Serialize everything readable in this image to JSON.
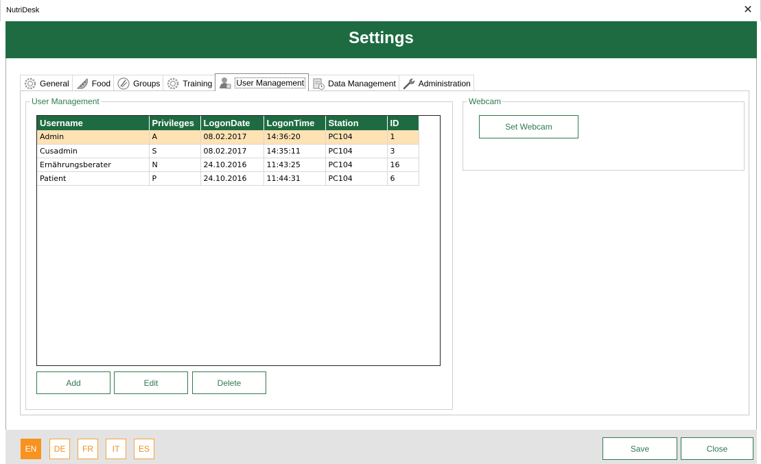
{
  "window": {
    "title": "NutriDesk",
    "close_glyph": "✕"
  },
  "header": {
    "title": "Settings"
  },
  "tabs": [
    {
      "label": "General",
      "icon": "gear-icon"
    },
    {
      "label": "Food",
      "icon": "pizza-icon"
    },
    {
      "label": "Groups",
      "icon": "fork-knife-icon"
    },
    {
      "label": "Training",
      "icon": "gear-icon"
    },
    {
      "label": "User Management",
      "icon": "user-icon",
      "active": true
    },
    {
      "label": "Data Management",
      "icon": "database-icon"
    },
    {
      "label": "Administration",
      "icon": "wrench-icon"
    }
  ],
  "user_management": {
    "group_title": "User Management",
    "columns": [
      "Username",
      "Privileges",
      "LogonDate",
      "LogonTime",
      "Station",
      "ID"
    ],
    "rows": [
      {
        "username": "Admin",
        "privileges": "A",
        "logon_date": "08.02.2017",
        "logon_time": "14:36:20",
        "station": "PC104",
        "id": "1",
        "selected": true
      },
      {
        "username": "Cusadmin",
        "privileges": "S",
        "logon_date": "08.02.2017",
        "logon_time": "14:35:11",
        "station": "PC104",
        "id": "3"
      },
      {
        "username": "Ernährungsberater",
        "privileges": "N",
        "logon_date": "24.10.2016",
        "logon_time": "11:43:25",
        "station": "PC104",
        "id": "16"
      },
      {
        "username": "Patient",
        "privileges": "P",
        "logon_date": "24.10.2016",
        "logon_time": "11:44:31",
        "station": "PC104",
        "id": "6"
      }
    ],
    "buttons": {
      "add": "Add",
      "edit": "Edit",
      "delete": "Delete"
    }
  },
  "webcam": {
    "group_title": "Webcam",
    "set_button": "Set Webcam"
  },
  "languages": [
    {
      "code": "EN",
      "active": true
    },
    {
      "code": "DE"
    },
    {
      "code": "FR"
    },
    {
      "code": "IT"
    },
    {
      "code": "ES"
    }
  ],
  "footer": {
    "save": "Save",
    "close": "Close"
  },
  "colors": {
    "brand_green": "#1e6b41",
    "accent_orange": "#f7931e",
    "selection": "#fde2b4"
  }
}
